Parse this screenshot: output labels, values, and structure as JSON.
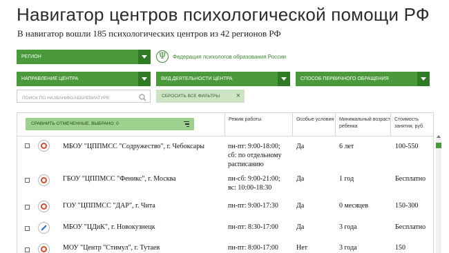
{
  "header": {
    "title": "Навигатор центров психологической помощи РФ",
    "subtitle": "В навигатор вошли 185 психологических центров из 42 регионов РФ"
  },
  "filters": {
    "region_label": "РЕГИОН",
    "direction_label": "НАПРАВЛЕНИЕ ЦЕНТРА",
    "activity_label": "ВИД ДЕЯТЕЛЬНОСТИ ЦЕНТРА",
    "appeal_label": "СПОСОБ ПЕРВИЧНОГО ОБРАЩЕНИЯ",
    "search_placeholder": "ПОИСК ПО НАЗВАНИЮ/АББРЕВИАТУРЕ",
    "reset_label": "СБРОСИТЬ ВСЕ ФИЛЬТРЫ",
    "reset_icon": "×",
    "colors": {
      "green": "#4a9a3c",
      "dark_green": "#2f7a25",
      "light_green": "#cde5c4",
      "compare_green": "#9ed18d"
    }
  },
  "federation": {
    "logo_symbol": "Ψ",
    "text": "Федерация психологов образования России"
  },
  "table": {
    "compare_label": "СРАВНИТЬ ОТМЕЧЕННЫЕ. ВЫБРАНО: 0",
    "columns": {
      "schedule": "Режим работы",
      "conditions": "Особые условия",
      "min_age": "Минимальный возраст ребенка",
      "cost": "Стоимость занятия, руб."
    },
    "rows": [
      {
        "icon": "circle-icon",
        "name": "МБОУ \"ЦППМСС \"Содружество\", г. Чебоксары",
        "schedule": [
          "пн-пт: 9:00-18:00;",
          "сб: по отдельному",
          "расписанию"
        ],
        "conditions": "Да",
        "min_age": "6 лет",
        "cost": "100-550"
      },
      {
        "icon": "circle-icon",
        "name": "ГБОУ \"ЦППМСС \"Феникс\", г. Москва",
        "schedule": [
          "пн-сб: 9:00-21:00;",
          "вс: 10:00-18:30"
        ],
        "conditions": "Да",
        "min_age": "1 год",
        "cost": "Бесплатно"
      },
      {
        "icon": "circle-icon",
        "name": "ГОУ \"ЦППМСС \"ДАР\", г. Чита",
        "schedule": [
          "пн-пт: 9:00-17:30"
        ],
        "conditions": "Да",
        "min_age": "0 месяцев",
        "cost": "150-300"
      },
      {
        "icon": "pen-icon",
        "name": "МБОУ \"ЦДиК\", г. Новокузнецк",
        "schedule": [
          "пн-пт: 8:30-17:00"
        ],
        "conditions": "Да",
        "min_age": "3 года",
        "cost": "Бесплатно"
      },
      {
        "icon": "circle-icon",
        "name": "МОУ \"Центр \"Стимул\", г. Тутаев",
        "schedule": [
          "пн-пт: 8:00-17:00"
        ],
        "conditions": "Нет",
        "min_age": "3 года",
        "cost": "150"
      }
    ]
  }
}
